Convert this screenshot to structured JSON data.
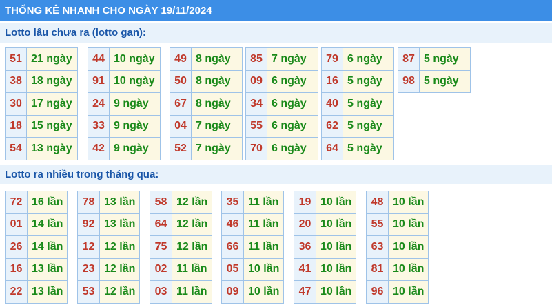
{
  "title": "THỐNG KÊ NHANH CHO NGÀY 19/11/2024",
  "sections": {
    "gan": {
      "label": "Lotto lâu chưa ra (lotto gan):",
      "groups": [
        [
          [
            "51",
            "21 ngày"
          ],
          [
            "38",
            "18 ngày"
          ],
          [
            "30",
            "17 ngày"
          ],
          [
            "18",
            "15 ngày"
          ],
          [
            "54",
            "13 ngày"
          ]
        ],
        [
          [
            "44",
            "10 ngày"
          ],
          [
            "91",
            "10 ngày"
          ],
          [
            "24",
            "9 ngày"
          ],
          [
            "33",
            "9 ngày"
          ],
          [
            "42",
            "9 ngày"
          ]
        ],
        [
          [
            "49",
            "8 ngày"
          ],
          [
            "50",
            "8 ngày"
          ],
          [
            "67",
            "8 ngày"
          ],
          [
            "04",
            "7 ngày"
          ],
          [
            "52",
            "7 ngày"
          ]
        ],
        [
          [
            "85",
            "7 ngày"
          ],
          [
            "09",
            "6 ngày"
          ],
          [
            "34",
            "6 ngày"
          ],
          [
            "55",
            "6 ngày"
          ],
          [
            "70",
            "6 ngày"
          ]
        ],
        [
          [
            "79",
            "6 ngày"
          ],
          [
            "16",
            "5 ngày"
          ],
          [
            "40",
            "5 ngày"
          ],
          [
            "62",
            "5 ngày"
          ],
          [
            "64",
            "5 ngày"
          ]
        ],
        [
          [
            "87",
            "5 ngày"
          ],
          [
            "98",
            "5 ngày"
          ]
        ]
      ]
    },
    "nhieu": {
      "label": "Lotto ra nhiều trong tháng qua:",
      "groups": [
        [
          [
            "72",
            "16 lần"
          ],
          [
            "01",
            "14 lần"
          ],
          [
            "26",
            "14 lần"
          ],
          [
            "16",
            "13 lần"
          ],
          [
            "22",
            "13 lần"
          ]
        ],
        [
          [
            "78",
            "13 lần"
          ],
          [
            "92",
            "13 lần"
          ],
          [
            "12",
            "12 lần"
          ],
          [
            "23",
            "12 lần"
          ],
          [
            "53",
            "12 lần"
          ]
        ],
        [
          [
            "58",
            "12 lần"
          ],
          [
            "64",
            "12 lần"
          ],
          [
            "75",
            "12 lần"
          ],
          [
            "02",
            "11 lần"
          ],
          [
            "03",
            "11 lần"
          ]
        ],
        [
          [
            "35",
            "11 lần"
          ],
          [
            "46",
            "11 lần"
          ],
          [
            "66",
            "11 lần"
          ],
          [
            "05",
            "10 lần"
          ],
          [
            "09",
            "10 lần"
          ]
        ],
        [
          [
            "19",
            "10 lần"
          ],
          [
            "20",
            "10 lần"
          ],
          [
            "36",
            "10 lần"
          ],
          [
            "41",
            "10 lần"
          ],
          [
            "47",
            "10 lần"
          ]
        ],
        [
          [
            "48",
            "10 lần"
          ],
          [
            "55",
            "10 lần"
          ],
          [
            "63",
            "10 lần"
          ],
          [
            "81",
            "10 lần"
          ],
          [
            "96",
            "10 lần"
          ]
        ]
      ]
    }
  }
}
